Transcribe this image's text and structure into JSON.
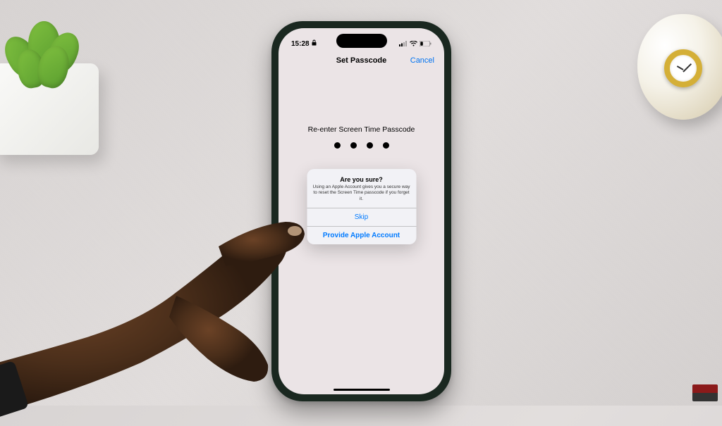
{
  "statusBar": {
    "time": "15:28",
    "lockIcon": "lock-icon"
  },
  "navBar": {
    "title": "Set Passcode",
    "cancel": "Cancel"
  },
  "content": {
    "prompt": "Re-enter Screen Time Passcode",
    "dotsFilled": 4
  },
  "alert": {
    "title": "Are you sure?",
    "message": "Using an Apple Account gives you a secure way to reset the Screen Time passcode if you forget it.",
    "skipLabel": "Skip",
    "provideLabel": "Provide Apple Account"
  }
}
